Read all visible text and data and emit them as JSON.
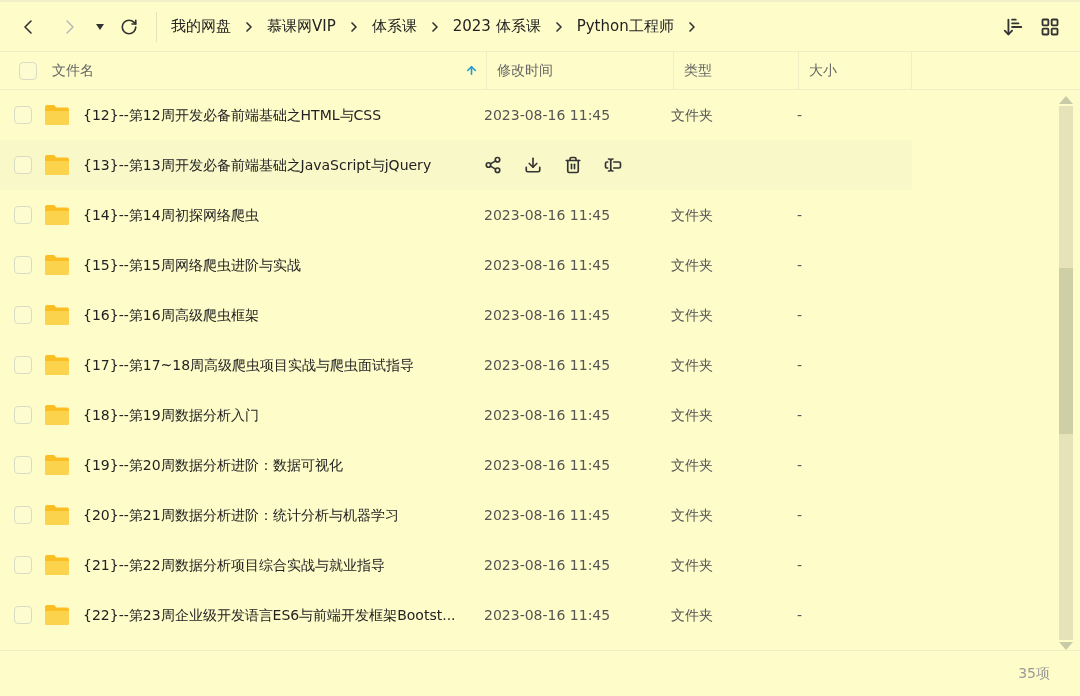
{
  "breadcrumbs": [
    "我的网盘",
    "慕课网VIP",
    "体系课",
    "2023 体系课",
    "Python工程师"
  ],
  "select_all": {
    "checked": false
  },
  "columns": [
    {
      "label": "文件名",
      "sorted": true
    },
    {
      "label": "修改时间",
      "sorted": false
    },
    {
      "label": "类型",
      "sorted": false
    },
    {
      "label": "大小",
      "sorted": false
    }
  ],
  "rows": [
    {
      "name": "{12}--第12周开发必备前端基础之HTML与CSS",
      "modified": "2023-08-16 11:45",
      "type": "文件夹",
      "size": "-",
      "hovered": false,
      "checked": false
    },
    {
      "name": "{13}--第13周开发必备前端基础之JavaScript与jQuery",
      "hovered": true,
      "checked": false
    },
    {
      "name": "{14}--第14周初探网络爬虫",
      "modified": "2023-08-16 11:45",
      "type": "文件夹",
      "size": "-",
      "hovered": false,
      "checked": false
    },
    {
      "name": "{15}--第15周网络爬虫进阶与实战",
      "modified": "2023-08-16 11:45",
      "type": "文件夹",
      "size": "-",
      "hovered": false,
      "checked": false
    },
    {
      "name": "{16}--第16周高级爬虫框架",
      "modified": "2023-08-16 11:45",
      "type": "文件夹",
      "size": "-",
      "hovered": false,
      "checked": false
    },
    {
      "name": "{17}--第17~18周高级爬虫项目实战与爬虫面试指导",
      "modified": "2023-08-16 11:45",
      "type": "文件夹",
      "size": "-",
      "hovered": false,
      "checked": false
    },
    {
      "name": "{18}--第19周数据分析入门",
      "modified": "2023-08-16 11:45",
      "type": "文件夹",
      "size": "-",
      "hovered": false,
      "checked": false
    },
    {
      "name": "{19}--第20周数据分析进阶：数据可视化",
      "modified": "2023-08-16 11:45",
      "type": "文件夹",
      "size": "-",
      "hovered": false,
      "checked": false
    },
    {
      "name": "{20}--第21周数据分析进阶：统计分析与机器学习",
      "modified": "2023-08-16 11:45",
      "type": "文件夹",
      "size": "-",
      "hovered": false,
      "checked": false
    },
    {
      "name": "{21}--第22周数据分析项目综合实战与就业指导",
      "modified": "2023-08-16 11:45",
      "type": "文件夹",
      "size": "-",
      "hovered": false,
      "checked": false
    },
    {
      "name": "{22}--第23周企业级开发语言ES6与前端开发框架Bootst...",
      "modified": "2023-08-16 11:45",
      "type": "文件夹",
      "size": "-",
      "hovered": false,
      "checked": false
    }
  ],
  "status": "35项"
}
